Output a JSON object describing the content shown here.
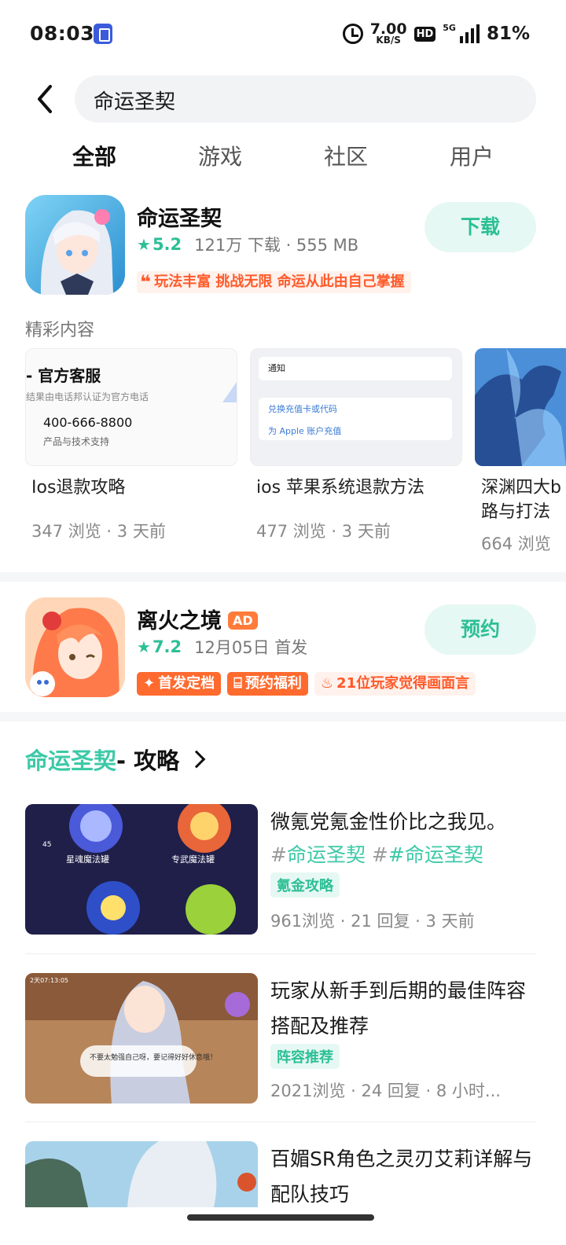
{
  "status_bar": {
    "time": "08:03",
    "net_speed_value": "7.00",
    "net_speed_unit": "KB/S",
    "hd_label": "HD",
    "network": "5G",
    "battery": "81%"
  },
  "search": {
    "query": "命运圣契"
  },
  "tabs": [
    {
      "label": "全部",
      "active": true
    },
    {
      "label": "游戏",
      "active": false
    },
    {
      "label": "社区",
      "active": false
    },
    {
      "label": "用户",
      "active": false
    }
  ],
  "main_app": {
    "name": "命运圣契",
    "rating": "5.2",
    "meta": "121万 下载 · 555 MB",
    "button": "下载",
    "slogan": "玩法丰富 挑战无限 命运从此由自己掌握"
  },
  "featured": {
    "label": "精彩内容",
    "cards": [
      {
        "title": "Ios退款攻略",
        "meta": "347 浏览 · 3 天前",
        "thumb_heading": "- 官方客服",
        "thumb_sub": "结果由电话邦认证为官方电话",
        "thumb_phone": "400-666-8800",
        "thumb_desc": "产品与技术支持"
      },
      {
        "title": "ios 苹果系统退款方法",
        "meta": "477 浏览 · 3 天前",
        "thumb_row1": "通知",
        "thumb_row2": "兑换充值卡或代码",
        "thumb_row3": "为 Apple 账户充值"
      },
      {
        "title": "深渊四大b路与打法",
        "meta": "664 浏览"
      }
    ]
  },
  "ad_app": {
    "name": "离火之境",
    "ad_label": "AD",
    "rating": "7.2",
    "meta": "12月05日 首发",
    "button": "预约",
    "tags": [
      "首发定档",
      "预约福利",
      "21位玩家觉得画面言"
    ]
  },
  "guides": {
    "title_game": "命运圣契",
    "title_suffix": " - 攻略",
    "posts": [
      {
        "title": "微氪党氪金性价比之我见。",
        "hashtags": [
          "命运圣契",
          "#命运圣契"
        ],
        "label": "氪金攻略",
        "meta": "961浏览 · 21 回复 · 3 天前",
        "thumb_text_1": "星魂魔法罐",
        "thumb_text_2": "专武魔法罐",
        "thumb_badge": "45"
      },
      {
        "title": "玩家从新手到后期的最佳阵容搭配及推荐",
        "label": "阵容推荐",
        "meta": "2021浏览 · 24 回复 · 8 小时...",
        "thumb_text_1": "不要太勉强自己呀，要记得好好休息哦！",
        "thumb_time": "2天07:13:05"
      },
      {
        "title": "百媚SR角色之灵刃艾莉详解与配队技巧"
      }
    ]
  },
  "colors": {
    "accent": "#3cc9a7",
    "accent_soft": "#e6f8f3",
    "orange": "#ff6a2e"
  }
}
